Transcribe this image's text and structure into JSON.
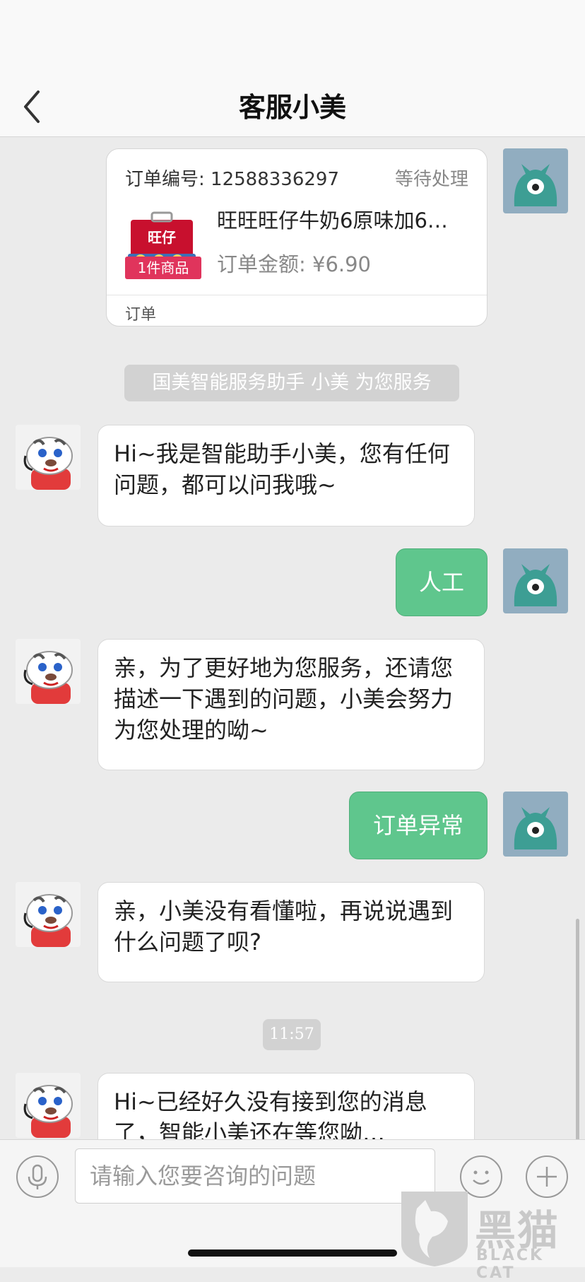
{
  "header": {
    "title": "客服小美"
  },
  "order": {
    "number_label": "订单编号: 12588336297",
    "status": "等待处理",
    "product_name": "旺旺旺仔牛奶6原味加6…",
    "amount_label": "订单金额: ¥6.90",
    "badge": "1件商品",
    "footer": "订单",
    "thumb_brand": "旺仔"
  },
  "system_notice": "国美智能服务助手 小美 为您服务",
  "messages": [
    {
      "from": "bot",
      "text": "Hi~我是智能助手小美，您有任何问题，都可以问我哦~"
    },
    {
      "from": "user",
      "text": "人工"
    },
    {
      "from": "bot",
      "text": "亲，为了更好地为您服务，还请您描述一下遇到的问题，小美会努力为您处理的呦~"
    },
    {
      "from": "user",
      "text": "订单异常"
    },
    {
      "from": "bot",
      "text": "亲，小美没有看懂啦，再说说遇到什么问题了呗?"
    },
    {
      "from": "bot",
      "text": "Hi~已经好久没有接到您的消息了，智能小美还在等您呦…"
    }
  ],
  "timestamp": "11:57",
  "input": {
    "placeholder": "请输入您要咨询的问题"
  },
  "watermark": {
    "text": "黑猫",
    "sub": "BLACK CAT"
  },
  "colors": {
    "user_bubble": "#5fc68d",
    "badge": "#e0345c",
    "background": "#ebebeb",
    "user_avatar_bg": "#91adc0"
  }
}
